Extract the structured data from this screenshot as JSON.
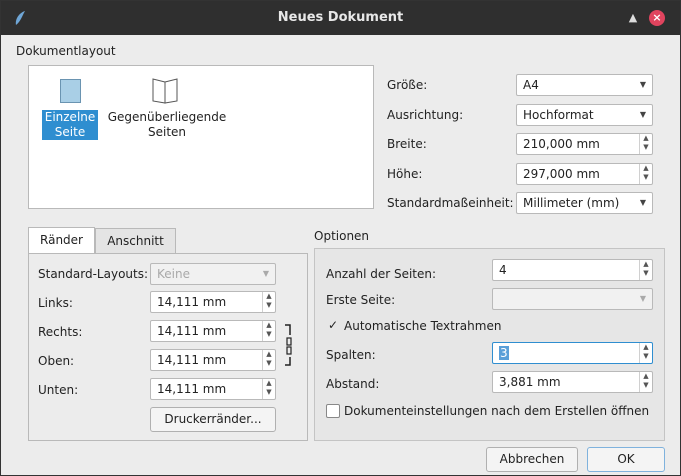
{
  "window": {
    "title": "Neues Dokument"
  },
  "layout_group": {
    "title": "Dokumentlayout",
    "options": [
      {
        "label_line1": "Einzelne",
        "label_line2": "Seite",
        "selected": true
      },
      {
        "label_line1": "Gegenüberliegende",
        "label_line2": "Seiten",
        "selected": false
      }
    ]
  },
  "page_settings": {
    "size": {
      "label": "Größe:",
      "value": "A4"
    },
    "orientation": {
      "label": "Ausrichtung:",
      "value": "Hochformat"
    },
    "width": {
      "label": "Breite:",
      "value": "210,000 mm"
    },
    "height": {
      "label": "Höhe:",
      "value": "297,000 mm"
    },
    "unit": {
      "label": "Standardmaßeinheit:",
      "value": "Millimeter (mm)"
    }
  },
  "margins_panel": {
    "tabs": [
      "Ränder",
      "Anschnitt"
    ],
    "active_tab": 0,
    "preset": {
      "label": "Standard-Layouts:",
      "value": "Keine"
    },
    "left": {
      "label": "Links:",
      "value": "14,111 mm"
    },
    "right": {
      "label": "Rechts:",
      "value": "14,111 mm"
    },
    "top": {
      "label": "Oben:",
      "value": "14,111 mm"
    },
    "bottom": {
      "label": "Unten:",
      "value": "14,111 mm"
    },
    "printer_margins_button": "Druckerränder..."
  },
  "options": {
    "title": "Optionen",
    "page_count": {
      "label": "Anzahl der Seiten:",
      "value": "4"
    },
    "first_page": {
      "label": "Erste Seite:",
      "value": ""
    },
    "auto_text_frames": {
      "label": "Automatische Textrahmen",
      "checked": true
    },
    "columns": {
      "label": "Spalten:",
      "value": "3"
    },
    "gap": {
      "label": "Abstand:",
      "value": "3,881 mm"
    },
    "open_settings": {
      "label": "Dokumenteinstellungen nach dem Erstellen öffnen",
      "checked": false
    }
  },
  "footer": {
    "cancel": "Abbrechen",
    "ok": "OK"
  },
  "colors": {
    "accent": "#2f8ed0",
    "titlebar": "#2f2f2f",
    "close": "#e0445e"
  }
}
